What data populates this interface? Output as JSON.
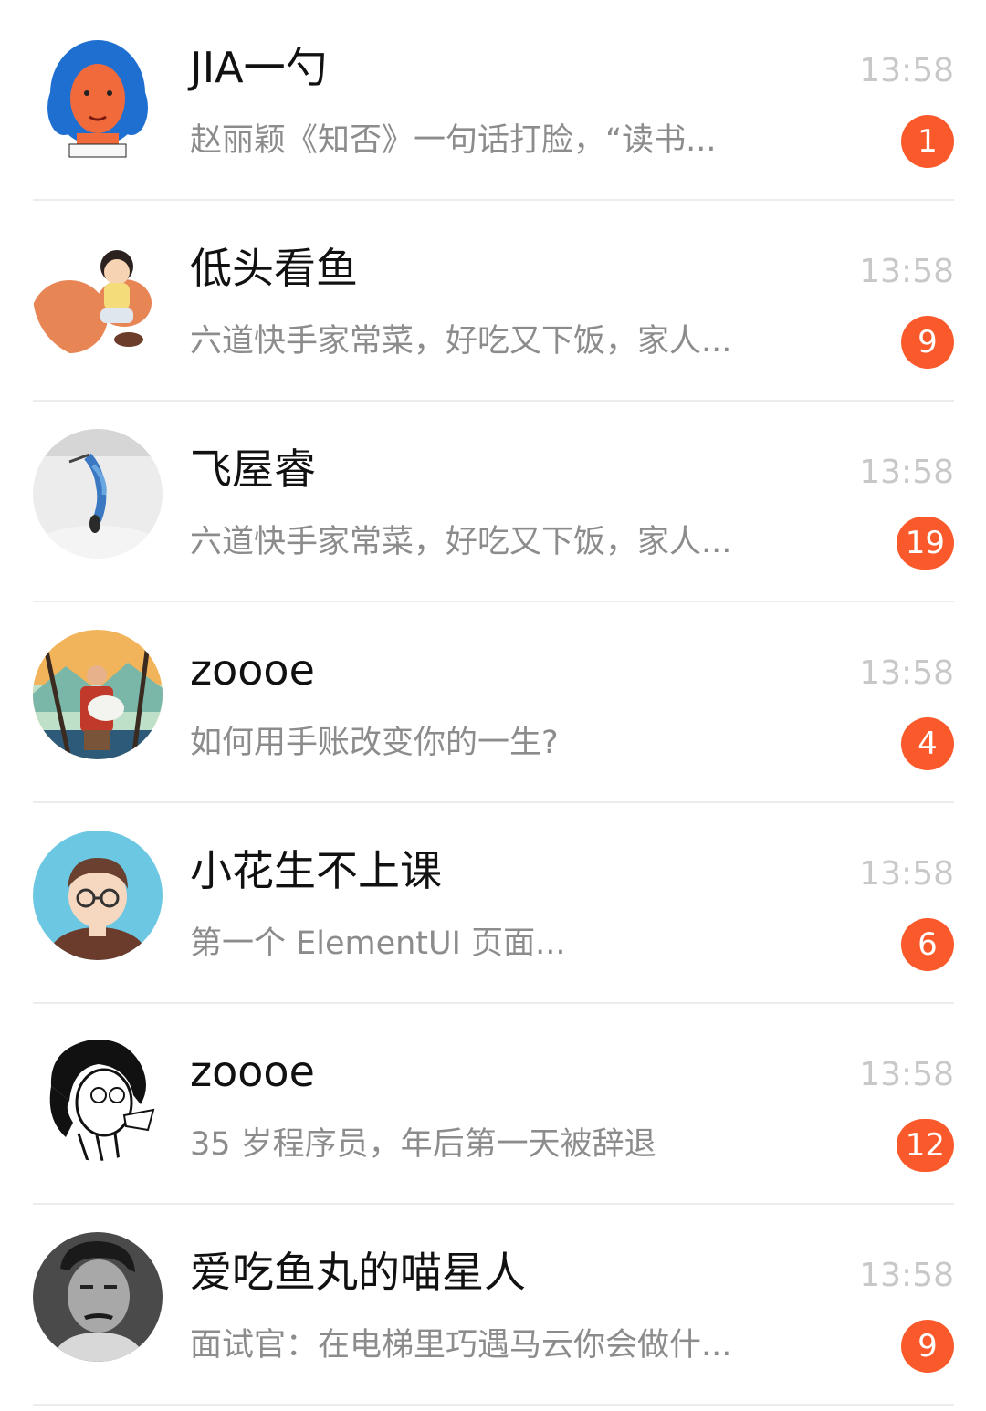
{
  "conversations": [
    {
      "name": "JIA一勺",
      "time": "13:58",
      "preview": "赵丽颖《知否》一句话打脸，“读书...",
      "unread": "1",
      "avatar": "cartoon-girl-blue-hair-avatar"
    },
    {
      "name": "低头看鱼",
      "time": "13:58",
      "preview": "六道快手家常菜，好吃又下饭，家人...",
      "unread": "9",
      "avatar": "girl-riding-squirrel-avatar"
    },
    {
      "name": "飞屋睿",
      "time": "13:58",
      "preview": "六道快手家常菜，好吃又下饭，家人...",
      "unread": "19",
      "avatar": "bird-sketch-avatar"
    },
    {
      "name": "zoooe",
      "time": "13:58",
      "preview": "如何用手账改变你的一生?",
      "unread": "4",
      "avatar": "man-holding-sheep-avatar"
    },
    {
      "name": "小花生不上课",
      "time": "13:58",
      "preview": "第一个 ElementUI 页面...",
      "unread": "6",
      "avatar": "boy-with-glasses-avatar"
    },
    {
      "name": "zoooe",
      "time": "13:58",
      "preview": "35 岁程序员，年后第一天被辞退",
      "unread": "12",
      "avatar": "curly-hair-sketch-avatar"
    },
    {
      "name": "爱吃鱼丸的喵星人",
      "time": "13:58",
      "preview": "面试官：在电梯里巧遇马云你会做什...",
      "unread": "9",
      "avatar": "portrait-photo-avatar"
    }
  ],
  "colors": {
    "badge": "#fa5a2b",
    "name": "#111111",
    "preview": "#8c8c8c",
    "time": "#c8c8c8",
    "divider": "#ececec"
  }
}
